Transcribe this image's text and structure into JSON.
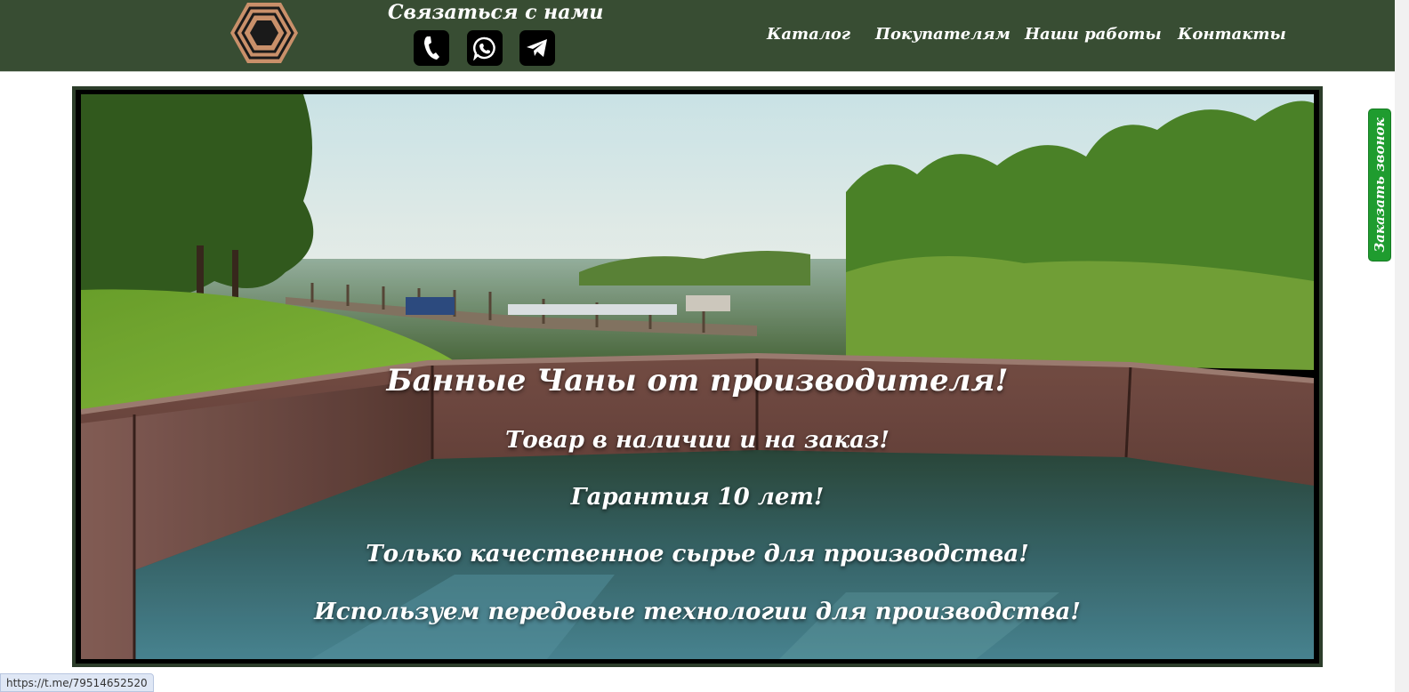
{
  "header": {
    "contact_title": "Связаться с нами",
    "contact_icons": [
      "phone-icon",
      "whatsapp-icon",
      "telegram-icon"
    ],
    "nav": [
      "Каталог",
      "Покупателям",
      "Наши работы",
      "Контакты"
    ],
    "background_color": "#384d33"
  },
  "hero": {
    "title": "Банные Чаны от производителя!",
    "lines": [
      "Товар в наличии и на заказ!",
      "Гарантия 10 лет!",
      "Только качественное сырье для производства!",
      "Используем передовые технологии для производства!"
    ]
  },
  "callback": {
    "label": "Заказать звонок",
    "color": "#1f9c2f"
  },
  "status_bar": {
    "url": "https://t.me/79514652520"
  }
}
